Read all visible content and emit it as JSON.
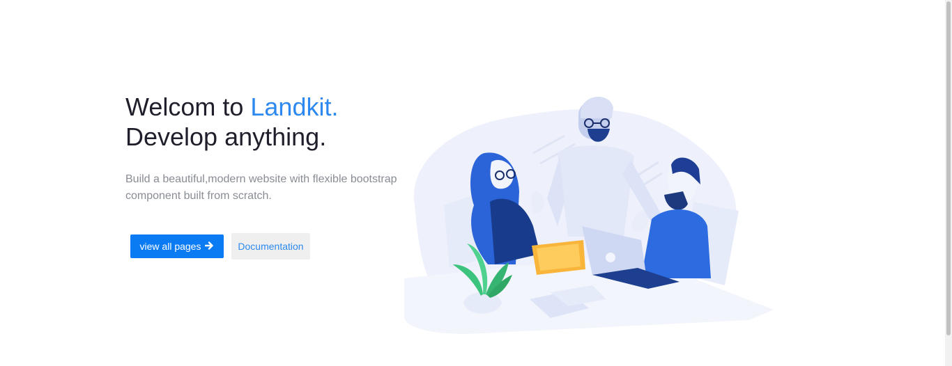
{
  "hero": {
    "title_prefix": "Welcom to ",
    "title_accent": "Landkit.",
    "title_line2": "Develop anything.",
    "subtitle": "Build a beautiful,modern website with flexible bootstrap component built from scratch."
  },
  "buttons": {
    "primary_label": "view all pages",
    "primary_icon": "arrow-right-icon",
    "secondary_label": "Documentation"
  },
  "colors": {
    "accent": "#2d89ef",
    "primary_button": "#0b7bf3",
    "secondary_button_bg": "#efefef"
  },
  "illustration": {
    "name": "team-meeting-illustration"
  }
}
